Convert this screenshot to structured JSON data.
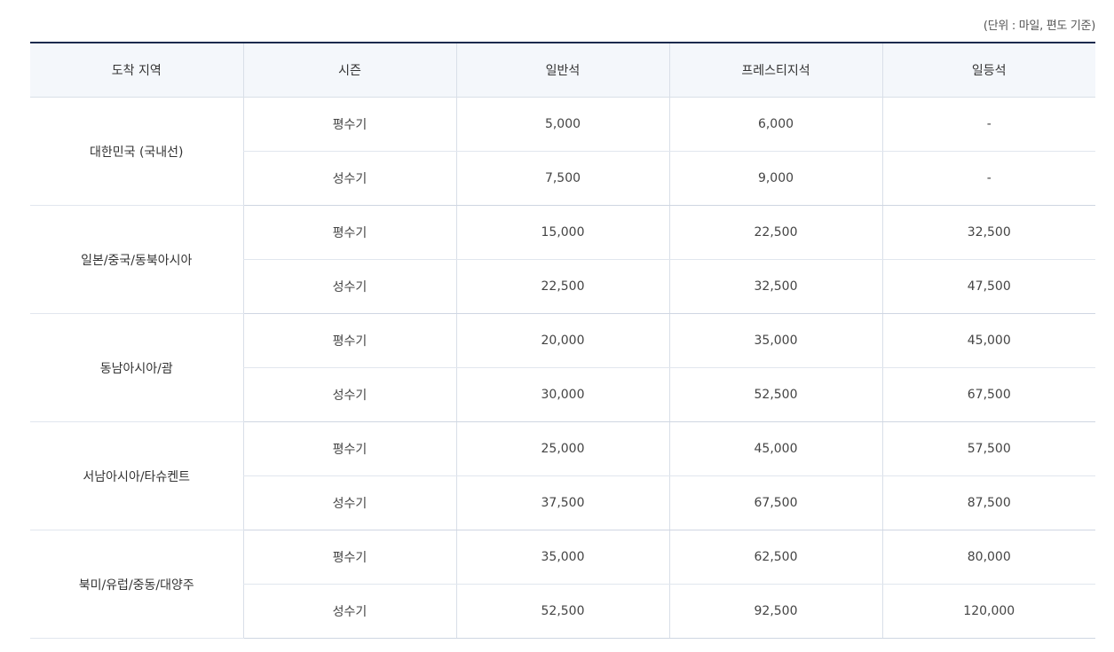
{
  "unit_note": "(단위 : 마일, 편도 기준)",
  "headers": [
    "도착 지역",
    "시즌",
    "일반석",
    "프레스티지석",
    "일등석"
  ],
  "rows": [
    {
      "region": "대한민국 (국내선)",
      "seasons": [
        {
          "season": "평수기",
          "economy": "5,000",
          "prestige": "6,000",
          "first": "-"
        },
        {
          "season": "성수기",
          "economy": "7,500",
          "prestige": "9,000",
          "first": "-"
        }
      ]
    },
    {
      "region": "일본/중국/동북아시아",
      "seasons": [
        {
          "season": "평수기",
          "economy": "15,000",
          "prestige": "22,500",
          "first": "32,500"
        },
        {
          "season": "성수기",
          "economy": "22,500",
          "prestige": "32,500",
          "first": "47,500"
        }
      ]
    },
    {
      "region": "동남아시아/괌",
      "seasons": [
        {
          "season": "평수기",
          "economy": "20,000",
          "prestige": "35,000",
          "first": "45,000"
        },
        {
          "season": "성수기",
          "economy": "30,000",
          "prestige": "52,500",
          "first": "67,500"
        }
      ]
    },
    {
      "region": "서남아시아/타슈켄트",
      "seasons": [
        {
          "season": "평수기",
          "economy": "25,000",
          "prestige": "45,000",
          "first": "57,500"
        },
        {
          "season": "성수기",
          "economy": "37,500",
          "prestige": "67,500",
          "first": "87,500"
        }
      ]
    },
    {
      "region": "북미/유럽/중동/대양주",
      "seasons": [
        {
          "season": "평수기",
          "economy": "35,000",
          "prestige": "62,500",
          "first": "80,000"
        },
        {
          "season": "성수기",
          "economy": "52,500",
          "prestige": "92,500",
          "first": "120,000"
        }
      ]
    }
  ]
}
